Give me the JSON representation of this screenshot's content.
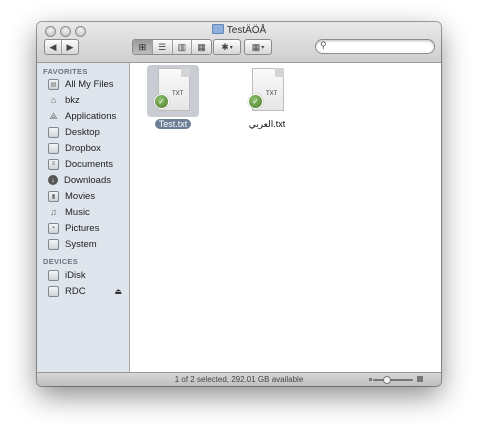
{
  "window": {
    "title": "TestÄÖÅ"
  },
  "toolbar": {
    "back_icon": "◀",
    "forward_icon": "▶",
    "view_icons": [
      "⊞",
      "☰",
      "▥",
      "▦"
    ],
    "action_icon": "✱",
    "arrange_icon": "▦",
    "search": {
      "icon": "⚲",
      "value": "",
      "placeholder": ""
    }
  },
  "sidebar": {
    "favorites_header": "FAVORITES",
    "favorites": [
      {
        "label": "All My Files",
        "icon": "all-files-icon"
      },
      {
        "label": "bkz",
        "icon": "home-icon"
      },
      {
        "label": "Applications",
        "icon": "applications-icon"
      },
      {
        "label": "Desktop",
        "icon": "desktop-icon"
      },
      {
        "label": "Dropbox",
        "icon": "folder-icon"
      },
      {
        "label": "Documents",
        "icon": "documents-icon"
      },
      {
        "label": "Downloads",
        "icon": "downloads-icon"
      },
      {
        "label": "Movies",
        "icon": "movies-icon"
      },
      {
        "label": "Music",
        "icon": "music-icon"
      },
      {
        "label": "Pictures",
        "icon": "pictures-icon"
      },
      {
        "label": "System",
        "icon": "folder-icon"
      }
    ],
    "devices_header": "DEVICES",
    "devices": [
      {
        "label": "iDisk",
        "icon": "idisk-icon"
      },
      {
        "label": "RDC",
        "icon": "drive-icon",
        "eject": "⏏"
      }
    ]
  },
  "files": [
    {
      "name": "Test.txt",
      "ext": "TXT",
      "selected": true
    },
    {
      "name": "العربي.txt",
      "ext": "TXT",
      "selected": false
    }
  ],
  "status": {
    "text": "1 of 2 selected, 292.01 GB available"
  }
}
